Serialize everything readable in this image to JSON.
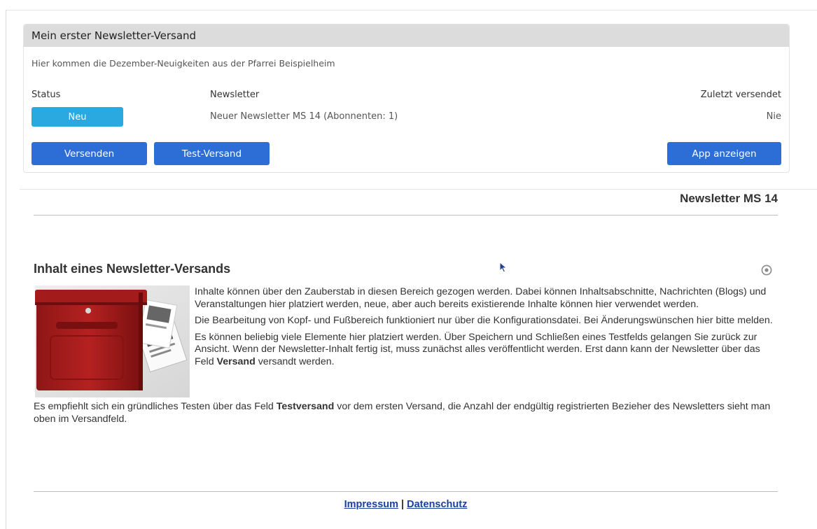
{
  "panel": {
    "title": "Mein erster Newsletter-Versand",
    "description": "Hier kommen die Dezember-Neuigkeiten aus der Pfarrei Beispielheim",
    "columns": {
      "status": "Status",
      "newsletter": "Newsletter",
      "last_sent": "Zuletzt versendet"
    },
    "values": {
      "status": "Neu",
      "newsletter": "Neuer Newsletter MS 14 (Abonnenten: 1)",
      "last_sent": "Nie"
    },
    "buttons": {
      "send": "Versenden",
      "test_send": "Test-Versand",
      "show_app": "App anzeigen"
    }
  },
  "newsletter": {
    "title": "Newsletter MS 14",
    "section_title": "Inhalt eines Newsletter-Versands",
    "para1": "Inhalte können über den Zauberstab in diesen Bereich gezogen werden. Dabei können Inhaltsabschnitte, Nachrichten (Blogs) und Veranstaltungen hier platziert werden, neue, aber auch bereits existierende Inhalte können hier verwendet werden.",
    "para2": "Die Bearbeitung von Kopf- und Fußbereich funktioniert nur über die Konfigurationsdatei. Bei Änderungswünschen hier bitte melden.",
    "para3_a": "Es können beliebig viele Elemente hier platziert werden. Über Speichern und Schließen  eines Testfelds gelangen Sie zurück zur Ansicht. Wenn der Newsletter-Inhalt fertig ist, muss zunächst alles veröffentlicht werden. Erst dann kann der Newsletter über das Feld ",
    "para3_bold": "Versand",
    "para3_b": " versandt werden.",
    "para4_a": "Es empfiehlt sich ein gründliches Testen über das Feld ",
    "para4_bold": "Testversand",
    "para4_b": " vor dem ersten Versand, die Anzahl der endgültig registrierten Bezieher des Newsletters sieht man oben im Versandfeld."
  },
  "footer": {
    "impressum": "Impressum",
    "separator": "|",
    "datenschutz": "Datenschutz"
  },
  "colors": {
    "status_badge": "#29a9e0",
    "button": "#2c6ed5",
    "header_bg": "#dcdcdc",
    "link": "#1a3fa0"
  }
}
